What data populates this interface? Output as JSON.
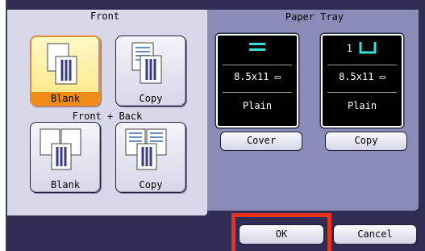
{
  "front": {
    "label": "Front",
    "blank_label": "Blank",
    "copy_label": "Copy"
  },
  "front_back": {
    "label": "Front + Back",
    "blank_label": "Blank",
    "copy_label": "Copy"
  },
  "paper_tray": {
    "label": "Paper Tray",
    "trays": [
      {
        "number": "",
        "icon": "tray-lines-icon",
        "size": "8.5x11",
        "type": "Plain"
      },
      {
        "number": "1",
        "icon": "tray-cup-icon",
        "size": "8.5x11",
        "type": "Plain"
      }
    ],
    "cover_label": "Cover",
    "copy_label": "Copy"
  },
  "footer": {
    "ok_label": "OK",
    "cancel_label": "Cancel"
  },
  "colors": {
    "selected_fill": "#ffe680",
    "selected_caption": "#f08a18",
    "highlight_outline": "#e8321e",
    "tray_accent": "#36e0e0"
  }
}
